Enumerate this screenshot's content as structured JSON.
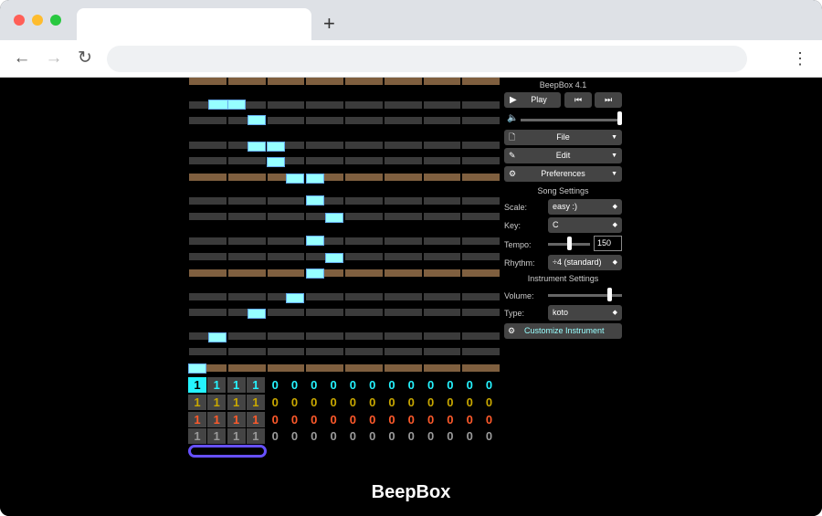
{
  "app": {
    "header": "BeepBox 4.1",
    "footer_title": "BeepBox"
  },
  "transport": {
    "play_label": "Play"
  },
  "menus": {
    "file_label": "File",
    "edit_label": "Edit",
    "preferences_label": "Preferences"
  },
  "song_settings": {
    "heading": "Song Settings",
    "scale_label": "Scale:",
    "scale_value": "easy :)",
    "key_label": "Key:",
    "key_value": "C",
    "tempo_label": "Tempo:",
    "tempo_value": "150",
    "rhythm_label": "Rhythm:",
    "rhythm_value": "÷4 (standard)"
  },
  "instrument_settings": {
    "heading": "Instrument Settings",
    "volume_label": "Volume:",
    "type_label": "Type:",
    "type_value": "koto",
    "customize_label": "Customize Instrument"
  },
  "pattern_grid": {
    "channels": [
      {
        "color": "#25f3ff",
        "values": [
          "1",
          "1",
          "1",
          "1",
          "0",
          "0",
          "0",
          "0",
          "0",
          "0",
          "0",
          "0",
          "0",
          "0",
          "0",
          "0"
        ]
      },
      {
        "color": "#c9a800",
        "values": [
          "1",
          "1",
          "1",
          "1",
          "0",
          "0",
          "0",
          "0",
          "0",
          "0",
          "0",
          "0",
          "0",
          "0",
          "0",
          "0"
        ]
      },
      {
        "color": "#ff5a2b",
        "values": [
          "1",
          "1",
          "1",
          "1",
          "0",
          "0",
          "0",
          "0",
          "0",
          "0",
          "0",
          "0",
          "0",
          "0",
          "0",
          "0"
        ]
      },
      {
        "color": "#9a9a9a",
        "values": [
          "1",
          "1",
          "1",
          "1",
          "0",
          "0",
          "0",
          "0",
          "0",
          "0",
          "0",
          "0",
          "0",
          "0",
          "0",
          "0"
        ]
      }
    ]
  },
  "levels": {
    "master_volume": 1.0,
    "tempo_slider": 0.5,
    "instrument_volume": 0.85
  },
  "colors": {
    "octave_row": "#7f5f3f",
    "pitch_row": "#3b3b3b",
    "note": "#96ffff",
    "selection": "#6650ff"
  }
}
